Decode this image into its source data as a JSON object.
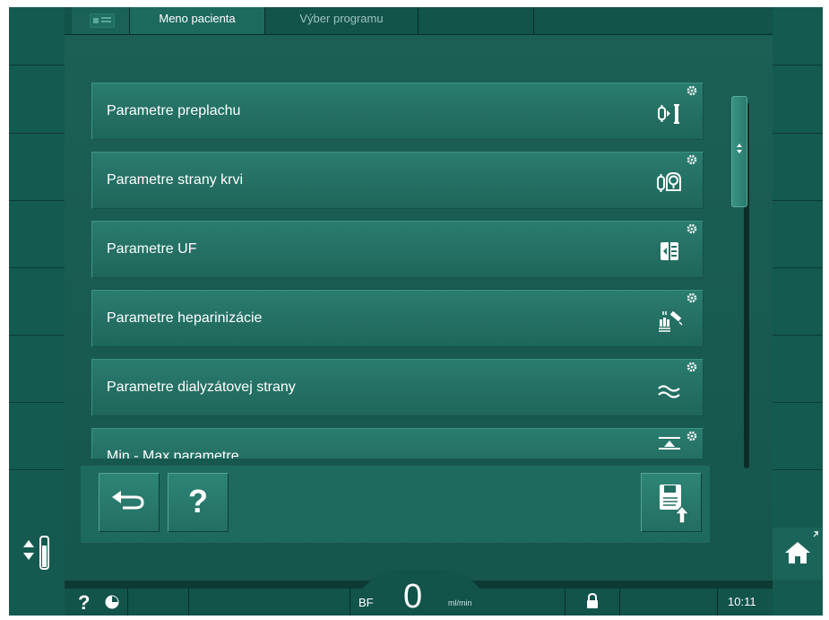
{
  "tabs": [
    {
      "label": ""
    },
    {
      "label": "Meno pacienta"
    },
    {
      "label": "Výber programu"
    }
  ],
  "menu_items": [
    {
      "label": "Parametre preplachu",
      "icon": "rinse-icon"
    },
    {
      "label": "Parametre strany krvi",
      "icon": "blood-pump-icon"
    },
    {
      "label": "Parametre UF",
      "icon": "uf-icon"
    },
    {
      "label": "Parametre heparinizácie",
      "icon": "heparin-syringe-icon"
    },
    {
      "label": "Parametre dialyzátovej strany",
      "icon": "dialysate-wave-icon"
    },
    {
      "label": "Min - Max parametre",
      "icon": "min-max-icon"
    }
  ],
  "toolbar": {
    "back_icon": "back-arrow-icon",
    "help_label": "?",
    "save_icon": "save-upload-icon"
  },
  "status": {
    "help_label": "?",
    "bf_label": "BF",
    "bf_value": "0",
    "bf_unit": "ml/min",
    "time": "10:11"
  },
  "colors": {
    "background": "#0d3a33",
    "panel": "#1b5f55",
    "button": "#2a7d70",
    "accent_text": "#ffffff"
  }
}
